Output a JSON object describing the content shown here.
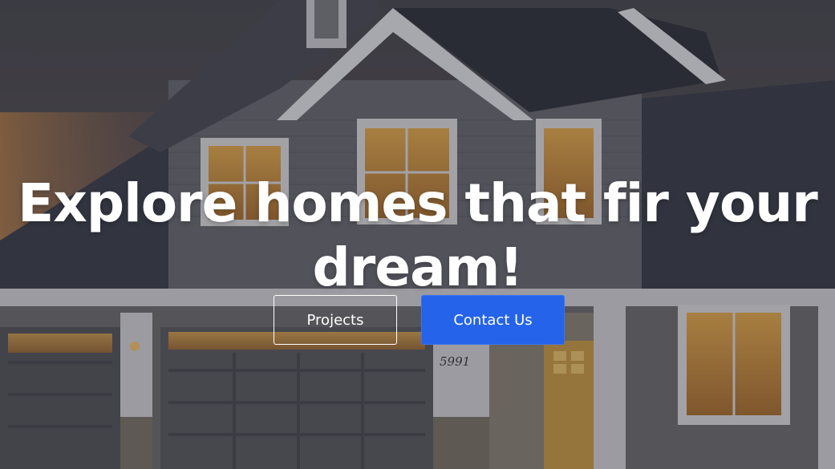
{
  "hero": {
    "headline_line1": "Explore homes that fir your",
    "headline_line2": "dream!",
    "house_number": "5991",
    "background_image": "suburban-house-at-dusk",
    "overlay_color": "#14141c"
  },
  "buttons": {
    "projects_label": "Projects",
    "contact_label": "Contact Us",
    "contact_color": "#2563eb"
  }
}
